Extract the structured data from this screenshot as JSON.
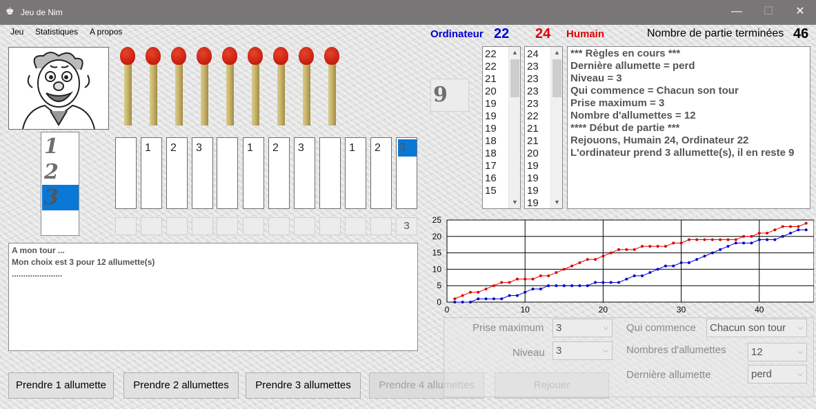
{
  "window": {
    "title": "Jeu de Nim",
    "minimize": "—",
    "maximize": "☐",
    "close": "✕"
  },
  "menu": [
    "Jeu",
    "Statistiques",
    "A propos"
  ],
  "score": {
    "ordinateur_label": "Ordinateur",
    "ordinateur_value": "22",
    "humain_value": "24",
    "humain_label": "Humain",
    "games_label": "Nombre de partie terminées",
    "games_value": "46",
    "ordinateur_color": "#0000d0",
    "humain_color": "#e00000"
  },
  "choice_digits": [
    "1",
    "2",
    "3"
  ],
  "selected_choice": 3,
  "matches_remaining": 9,
  "slots": [
    "",
    "1",
    "2",
    "3",
    "",
    "1",
    "2",
    "3",
    "",
    "1",
    "2",
    "3"
  ],
  "slot_inputs": [
    "",
    "",
    "",
    "",
    "",
    "",
    "",
    "",
    "",
    "",
    "",
    "3"
  ],
  "remaining_display": "9",
  "log": [
    "A mon tour ...",
    "Mon choix est 3 pour 12 allumette(s)",
    "......................"
  ],
  "buttons": {
    "take1": "Prendre 1 allumette",
    "take2": "Prendre 2 allumettes",
    "take3": "Prendre 3 allumettes",
    "take4": "Prendre 4 allumettes",
    "replay": "Rejouer"
  },
  "list_ordinateur": [
    "22",
    "22",
    "21",
    "20",
    "19",
    "19",
    "19",
    "18",
    "18",
    "17",
    "16",
    "15"
  ],
  "list_humain": [
    "24",
    "23",
    "23",
    "23",
    "23",
    "22",
    "21",
    "21",
    "20",
    "19",
    "19",
    "19",
    "19"
  ],
  "rules": [
    "*** Règles en cours ***",
    "Dernière allumette = perd",
    "Niveau = 3",
    "Qui commence = Chacun son tour",
    "Prise maximum = 3",
    "Nombre d'allumettes = 12",
    "**** Début de partie ***",
    "Rejouons, Humain 24, Ordinateur 22",
    "L'ordinateur prend 3 allumette(s), il en reste 9"
  ],
  "settings": {
    "prise_label": "Prise maximum",
    "prise_value": "3",
    "niveau_label": "Niveau",
    "niveau_value": "3",
    "qui_label": "Qui commence",
    "qui_value": "Chacun son tour",
    "nb_label": "Nombres d'allumettes",
    "nb_value": "12",
    "derniere_label": "Dernière allumette",
    "derniere_value": "perd"
  },
  "chart_data": {
    "type": "line",
    "xlim": [
      0,
      47
    ],
    "ylim": [
      0,
      25
    ],
    "x_ticks": [
      "0",
      "10",
      "20",
      "30",
      "40"
    ],
    "y_ticks": [
      "0",
      "5",
      "10",
      "15",
      "20",
      "25"
    ],
    "grid": true,
    "series": [
      {
        "color": "#e00000",
        "x": [
          1,
          2,
          3,
          4,
          5,
          6,
          7,
          8,
          9,
          10,
          11,
          12,
          13,
          14,
          15,
          16,
          17,
          18,
          19,
          20,
          21,
          22,
          23,
          24,
          25,
          26,
          27,
          28,
          29,
          30,
          31,
          32,
          33,
          34,
          35,
          36,
          37,
          38,
          39,
          40,
          41,
          42,
          43,
          44,
          45,
          46
        ],
        "values": [
          1,
          2,
          3,
          3,
          4,
          5,
          6,
          6,
          7,
          7,
          7,
          8,
          8,
          9,
          10,
          11,
          12,
          13,
          13,
          14,
          15,
          16,
          16,
          16,
          17,
          17,
          17,
          17,
          18,
          18,
          19,
          19,
          19,
          19,
          19,
          19,
          19,
          20,
          20,
          21,
          21,
          22,
          23,
          23,
          23,
          24
        ]
      },
      {
        "color": "#0000d0",
        "x": [
          1,
          2,
          3,
          4,
          5,
          6,
          7,
          8,
          9,
          10,
          11,
          12,
          13,
          14,
          15,
          16,
          17,
          18,
          19,
          20,
          21,
          22,
          23,
          24,
          25,
          26,
          27,
          28,
          29,
          30,
          31,
          32,
          33,
          34,
          35,
          36,
          37,
          38,
          39,
          40,
          41,
          42,
          43,
          44,
          45,
          46
        ],
        "values": [
          0,
          0,
          0,
          1,
          1,
          1,
          1,
          2,
          2,
          3,
          4,
          4,
          5,
          5,
          5,
          5,
          5,
          5,
          6,
          6,
          6,
          6,
          7,
          8,
          8,
          9,
          10,
          11,
          11,
          12,
          12,
          13,
          14,
          15,
          16,
          17,
          18,
          18,
          18,
          19,
          19,
          19,
          20,
          21,
          22,
          22
        ]
      }
    ]
  }
}
